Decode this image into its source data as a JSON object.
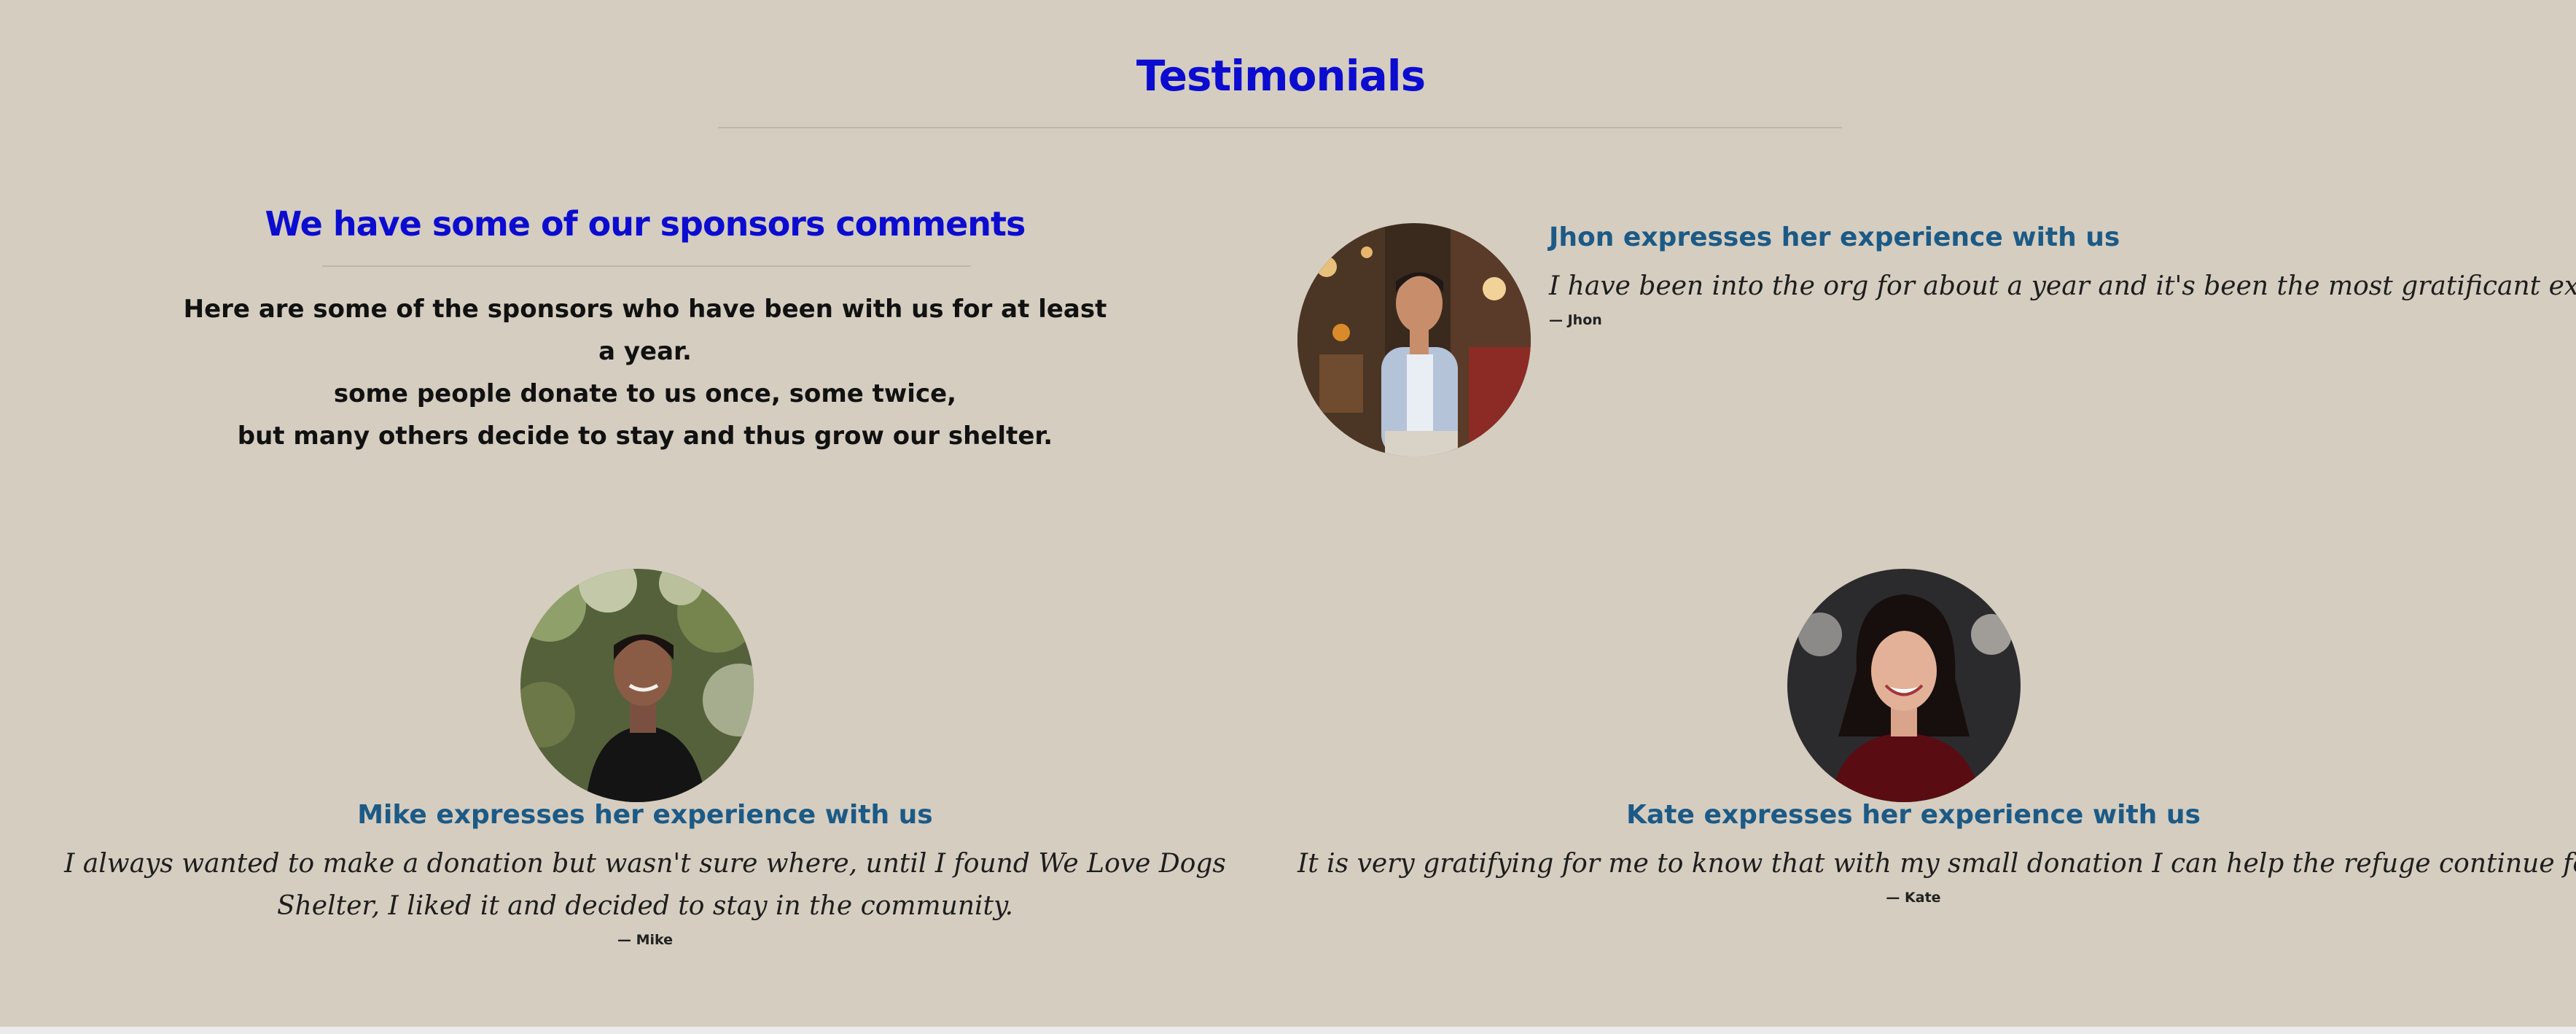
{
  "page": {
    "title": "Testimonials"
  },
  "intro": {
    "title": "We have some of our sponsors comments",
    "lines": [
      "Here are some of the sponsors who have been with us for at least a year.",
      "some people donate to us once, some twice,",
      "but many others decide to stay and thus grow our shelter."
    ]
  },
  "testimonials": [
    {
      "heading": "Jhon expresses her experience with us",
      "quote": "I have been into the org for about a year and it's been the most gratificant experience.",
      "author": "— Jhon",
      "avatar_icon": "photo-man-in-restaurant"
    },
    {
      "heading": "Mike expresses her experience with us",
      "quote": "I always wanted to make a donation but wasn't sure where, until I found We Love Dogs Shelter, I liked it and decided to stay in the community.",
      "author": "— Mike",
      "avatar_icon": "photo-man-in-garden"
    },
    {
      "heading": "Kate expresses her experience with us",
      "quote": "It is very gratifying for me to know that with my small donation I can help the refuge continue forward.",
      "author": "— Kate",
      "avatar_icon": "photo-smiling-woman"
    }
  ],
  "colors": {
    "background": "#d5cdc0",
    "title_blue": "#0c0cd0",
    "heading_blue": "#1c5a86"
  }
}
